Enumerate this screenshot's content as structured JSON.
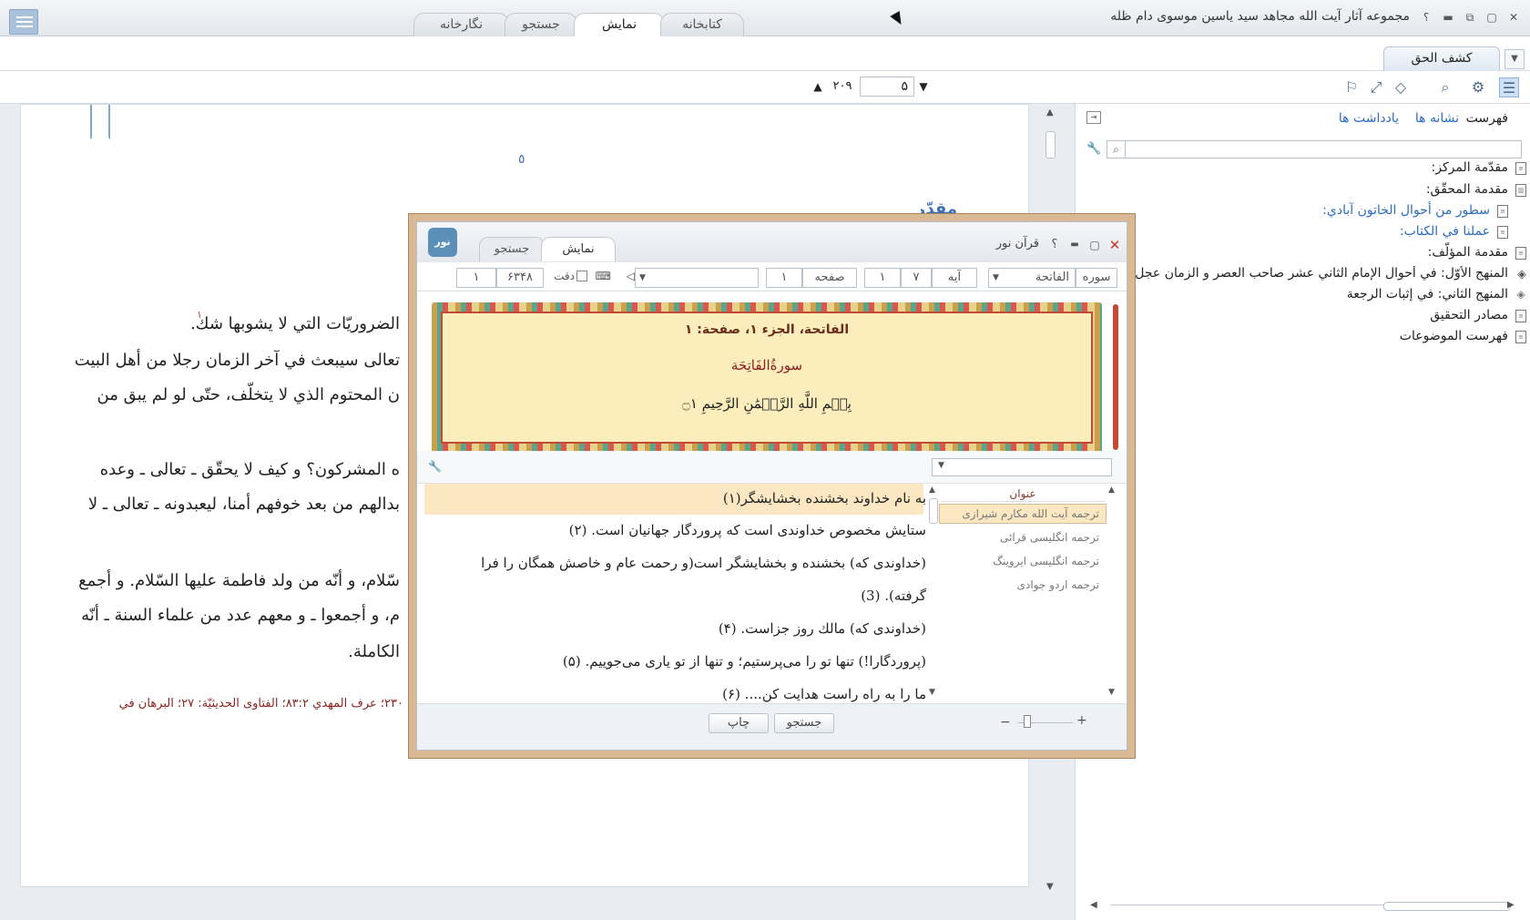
{
  "titlebar": {
    "app_title": "مجموعه آثار آیت الله مجاهد سید یاسین موسوی دام ظله",
    "tabs": [
      "کتابخانه",
      "نمایش",
      "جستجو",
      "نگارخانه"
    ],
    "help": "؟"
  },
  "docrow": {
    "tab_label": "كشف الحق"
  },
  "toolbar": {
    "page_current": "۵",
    "page_total": "۲۰۹"
  },
  "document": {
    "page_number": "٥",
    "heading_fragment": "مقدّمة المركز",
    "lines": [
      "الضروريّات التي لا يشوبها شك.",
      "تعالى سيبعث في آخر الزمان رجلا من أهل البيت",
      "ن المحتوم الذي لا يتخلّف، حتّى لو لم يبق من",
      "ه المشركون؟ و كيف لا يحقّق ـ تعالى ـ وعده",
      "بدالهم من بعد خوفهم أمنا، ليعبدونه ـ تعالى ـ لا",
      "سّلام، و أنّه من ولد فاطمة عليها السّلام. و أجمع",
      "م، و أجمعوا ـ و معهم عدد من علماء السنة ـ أنّه",
      "الكاملة."
    ],
    "footnote_mark": "١",
    "footnote": "۲۳۰؛ عرف المهدي ۸۳:۲؛ الفتاوى الحديثيّة: ۲۷؛ البرهان في"
  },
  "sidebar": {
    "tabs": [
      "فهرست",
      "نشانه ها",
      "يادداشت ها"
    ],
    "search_placeholder": "",
    "items": [
      {
        "label": "مقدّمة المركز:",
        "link": false
      },
      {
        "label": "مقدمة المحقّق:",
        "link": false
      },
      {
        "label": "سطور من أحوال الخاتون آبادي:",
        "link": true
      },
      {
        "label": "عملنا في الكتاب:",
        "link": true
      },
      {
        "label": "مقدمة المؤلّف:",
        "link": false
      },
      {
        "label": "المنهج الأوّل: في أحوال الإمام الثاني عشر صاحب العصر و الزمان عجل الله",
        "link": false
      },
      {
        "label": "المنهج الثاني: في إثبات الرجعة",
        "link": false
      },
      {
        "label": "مصادر التحقيق",
        "link": false
      },
      {
        "label": "فهرست الموضوعات",
        "link": false
      }
    ]
  },
  "quran": {
    "title": "قرآن نور",
    "tabs": [
      "نمایش",
      "جستجو"
    ],
    "logo": "نور",
    "fields": {
      "sura_label": "سوره",
      "sura_value": "الفاتحة",
      "aya_label": "آیه",
      "aya_value": "۷",
      "aya_current": "۱",
      "page_label": "صفحه",
      "page_value": "۱",
      "precision_label": "دقت",
      "total": "۶۳۴۸",
      "total_current": "۱"
    },
    "page_header": "الفاتحة، الجزء ۱، صفحة: ۱",
    "sura_name": "سورةُالفَاتِحَة",
    "basmala": "بِسۡمِ اللَّهِ الرَّحۡمَٰنِ الرَّحِيمِ ۝١",
    "verses": [
      "به نام خداوند بخشنده بخشايشگر(۱)",
      "ستايش مخصوص خداوندى است كه پروردگار جهانيان است. (۲)",
      "(خداوندى كه) بخشنده و بخشايشگر است(و رحمت عام و خاصش همگان را فرا",
      "گرفته). (3)",
      "(خداوندى كه) مالك روز جزاست. (۴)",
      "(پروردگارا!) تنها تو را مى‌پرستيم؛ و تنها از تو يارى مى‌جوييم. (۵)",
      "ما را به راه راست هدايت كن.... (۶)"
    ],
    "translations_header": "عنوان",
    "translations": [
      "ترجمه آيت الله مكارم شيرازى",
      "ترجمه انگليسى قرائى",
      "ترجمه انگليسى ايروينگ",
      "ترجمه اردو جوادى"
    ],
    "buttons": {
      "print": "چاپ",
      "search": "جستجو"
    }
  }
}
